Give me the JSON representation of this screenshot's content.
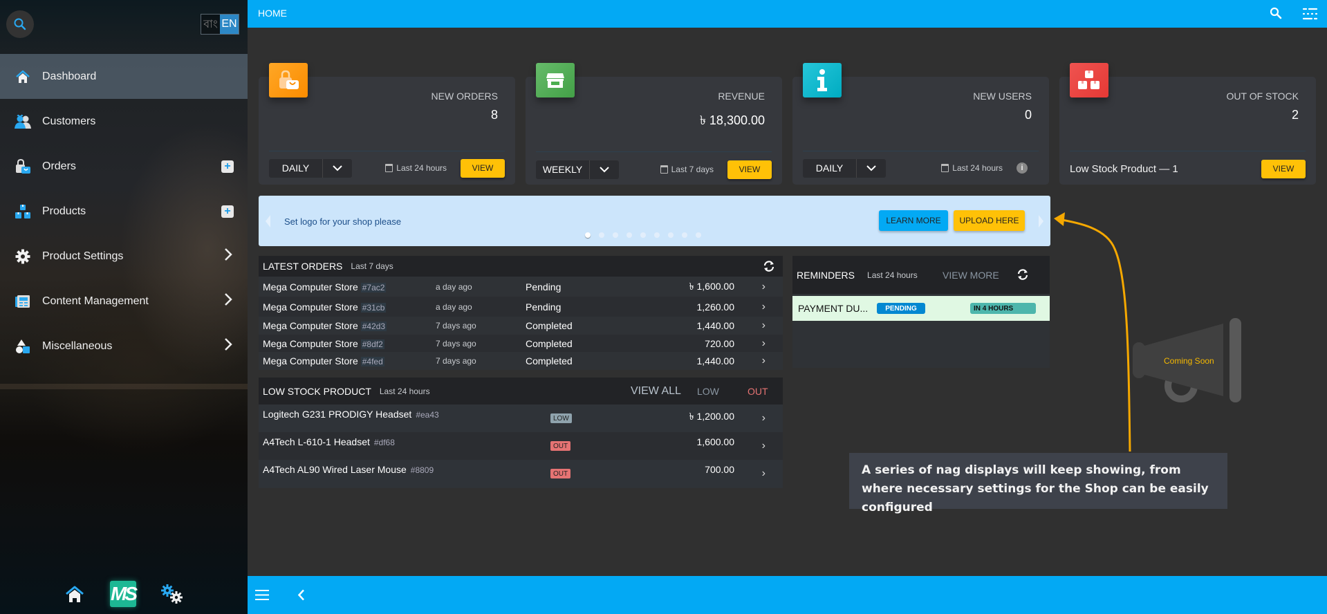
{
  "sidebar": {
    "lang": {
      "bn": "বাং",
      "en": "EN"
    },
    "items": [
      {
        "label": "Dashboard",
        "icon": "home-icon",
        "active": true
      },
      {
        "label": "Customers",
        "icon": "users-icon"
      },
      {
        "label": "Orders",
        "icon": "shopping-bag-icon",
        "action": "plus"
      },
      {
        "label": "Products",
        "icon": "boxes-icon",
        "action": "plus"
      },
      {
        "label": "Product Settings",
        "icon": "gear-icon",
        "action": "chevron"
      },
      {
        "label": "Content Management",
        "icon": "newspaper-icon",
        "action": "chevron"
      },
      {
        "label": "Miscellaneous",
        "icon": "shapes-icon",
        "action": "chevron"
      }
    ],
    "plus": "+",
    "chevron": "›",
    "logo_text": "MS"
  },
  "topbar": {
    "title": "HOME"
  },
  "cards": [
    {
      "title": "NEW ORDERS",
      "value": "8",
      "period": "DAILY",
      "range": "Last 24 hours",
      "action": "VIEW",
      "color": "#ff9800"
    },
    {
      "title": "REVENUE",
      "value": "৳  18,300.00",
      "period": "WEEKLY",
      "range": "Last 7 days",
      "action": "VIEW",
      "color": "#43a047"
    },
    {
      "title": "NEW USERS",
      "value": "0",
      "period": "DAILY",
      "range": "Last 24 hours",
      "color": "#00acc1"
    },
    {
      "title": "OUT OF STOCK",
      "value": "2",
      "footer": "Low Stock Product — 1",
      "action": "VIEW",
      "color": "#e53935"
    }
  ],
  "banner": {
    "message": "Set logo for your shop please",
    "learn_more": "LEARN MORE",
    "upload": "UPLOAD HERE",
    "slide_count": 9,
    "active_slide": 1
  },
  "latest_orders": {
    "title": "LATEST ORDERS",
    "subtitle": "Last 7 days",
    "rows": [
      {
        "store": "Mega Computer Store",
        "id": "#7ac2",
        "ago": "a day ago",
        "status": "Pending",
        "amount": "৳ 1,600.00"
      },
      {
        "store": "Mega Computer Store",
        "id": "#31cb",
        "ago": "a day ago",
        "status": "Pending",
        "amount": "1,260.00"
      },
      {
        "store": "Mega Computer Store",
        "id": "#42d3",
        "ago": "7 days ago",
        "status": "Completed",
        "amount": "1,440.00"
      },
      {
        "store": "Mega Computer Store",
        "id": "#8df2",
        "ago": "7 days ago",
        "status": "Completed",
        "amount": "720.00"
      },
      {
        "store": "Mega Computer Store",
        "id": "#4fed",
        "ago": "7 days ago",
        "status": "Completed",
        "amount": "1,440.00"
      }
    ]
  },
  "low_stock": {
    "title": "LOW STOCK PRODUCT",
    "subtitle": "Last 24 hours",
    "view_all": "VIEW ALL",
    "low": "LOW",
    "out": "OUT",
    "rows": [
      {
        "name": "Logitech G231 PRODIGY Headset",
        "id": "#ea43",
        "tag": "LOW",
        "amount": "৳ 1,200.00"
      },
      {
        "name": "A4Tech L-610-1 Headset",
        "id": "#df68",
        "tag": "OUT",
        "amount": "1,600.00"
      },
      {
        "name": "A4Tech AL90 Wired Laser Mouse",
        "id": "#8809",
        "tag": "OUT",
        "amount": "700.00"
      }
    ]
  },
  "reminders": {
    "title": "REMINDERS",
    "subtitle": "Last 24 hours",
    "view_more": "VIEW MORE",
    "rows": [
      {
        "title": "PAYMENT DU...",
        "status": "PENDING",
        "due": "IN 4 HOURS"
      }
    ]
  },
  "coming_soon": "Coming Soon",
  "callout": "A series of nag displays will keep showing, from where necessary settings for the Shop can be easily configured"
}
